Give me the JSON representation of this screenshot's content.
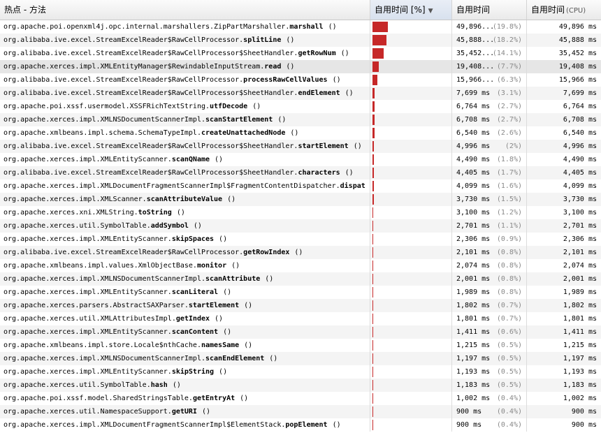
{
  "header": {
    "col_method": "热点 - 方法",
    "col_self_pct": "自用时间 [%]",
    "col_self_time": "自用时间",
    "col_cpu": "自用时间",
    "col_cpu_suffix": "(CPU)",
    "sort_icon": "triangle-down-icon"
  },
  "colors": {
    "bar": "#c62828",
    "selected_row": "#e6e6e6"
  },
  "rows": [
    {
      "pkg": "org.apache.poi.openxml4j.opc.internal.marshallers.ZipPartMarshaller.",
      "name": "marshall",
      "paren": "()",
      "time": "49,896...",
      "pct": "(19.8%)",
      "cpu": "49,896 ms",
      "share": 0.198
    },
    {
      "pkg": "org.alibaba.ive.excel.StreamExcelReader$RawCellProcessor.",
      "name": "splitLine",
      "paren": "()",
      "time": "45,888...",
      "pct": "(18.2%)",
      "cpu": "45,888 ms",
      "share": 0.182
    },
    {
      "pkg": "org.alibaba.ive.excel.StreamExcelReader$RawCellProcessor$SheetHandler.",
      "name": "getRowNum",
      "paren": "()",
      "time": "35,452...",
      "pct": "(14.1%)",
      "cpu": "35,452 ms",
      "share": 0.141
    },
    {
      "pkg": "org.apache.xerces.impl.XMLEntityManager$RewindableInputStream.",
      "name": "read",
      "paren": "()",
      "time": "19,408...",
      "pct": "(7.7%)",
      "cpu": "19,408 ms",
      "share": 0.077,
      "selected": true
    },
    {
      "pkg": "org.alibaba.ive.excel.StreamExcelReader$RawCellProcessor.",
      "name": "processRawCellValues",
      "paren": "()",
      "time": "15,966...",
      "pct": "(6.3%)",
      "cpu": "15,966 ms",
      "share": 0.063
    },
    {
      "pkg": "org.alibaba.ive.excel.StreamExcelReader$RawCellProcessor$SheetHandler.",
      "name": "endElement",
      "paren": "()",
      "time": "7,699 ms",
      "pct": "(3.1%)",
      "cpu": "7,699 ms",
      "share": 0.031
    },
    {
      "pkg": "org.apache.poi.xssf.usermodel.XSSFRichTextString.",
      "name": "utfDecode",
      "paren": "()",
      "time": "6,764 ms",
      "pct": "(2.7%)",
      "cpu": "6,764 ms",
      "share": 0.027
    },
    {
      "pkg": "org.apache.xerces.impl.XMLNSDocumentScannerImpl.",
      "name": "scanStartElement",
      "paren": "()",
      "time": "6,708 ms",
      "pct": "(2.7%)",
      "cpu": "6,708 ms",
      "share": 0.027
    },
    {
      "pkg": "org.apache.xmlbeans.impl.schema.SchemaTypeImpl.",
      "name": "createUnattachedNode",
      "paren": "()",
      "time": "6,540 ms",
      "pct": "(2.6%)",
      "cpu": "6,540 ms",
      "share": 0.026
    },
    {
      "pkg": "org.alibaba.ive.excel.StreamExcelReader$RawCellProcessor$SheetHandler.",
      "name": "startElement",
      "paren": "()",
      "time": "4,996 ms",
      "pct": "(2%)",
      "cpu": "4,996 ms",
      "share": 0.02
    },
    {
      "pkg": "org.apache.xerces.impl.XMLEntityScanner.",
      "name": "scanQName",
      "paren": "()",
      "time": "4,490 ms",
      "pct": "(1.8%)",
      "cpu": "4,490 ms",
      "share": 0.018
    },
    {
      "pkg": "org.alibaba.ive.excel.StreamExcelReader$RawCellProcessor$SheetHandler.",
      "name": "characters",
      "paren": "()",
      "time": "4,405 ms",
      "pct": "(1.7%)",
      "cpu": "4,405 ms",
      "share": 0.017
    },
    {
      "pkg": "org.apache.xerces.impl.XMLDocumentFragmentScannerImpl$FragmentContentDispatcher.",
      "name": "dispat",
      "paren": "",
      "time": "4,099 ms",
      "pct": "(1.6%)",
      "cpu": "4,099 ms",
      "share": 0.016
    },
    {
      "pkg": "org.apache.xerces.impl.XMLScanner.",
      "name": "scanAttributeValue",
      "paren": "()",
      "time": "3,730 ms",
      "pct": "(1.5%)",
      "cpu": "3,730 ms",
      "share": 0.015
    },
    {
      "pkg": "org.apache.xerces.xni.XMLString.",
      "name": "toString",
      "paren": "()",
      "time": "3,100 ms",
      "pct": "(1.2%)",
      "cpu": "3,100 ms",
      "share": 0.012
    },
    {
      "pkg": "org.apache.xerces.util.SymbolTable.",
      "name": "addSymbol",
      "paren": "()",
      "time": "2,701 ms",
      "pct": "(1.1%)",
      "cpu": "2,701 ms",
      "share": 0.011
    },
    {
      "pkg": "org.apache.xerces.impl.XMLEntityScanner.",
      "name": "skipSpaces",
      "paren": "()",
      "time": "2,306 ms",
      "pct": "(0.9%)",
      "cpu": "2,306 ms",
      "share": 0.009
    },
    {
      "pkg": "org.alibaba.ive.excel.StreamExcelReader$RawCellProcessor.",
      "name": "getRowIndex",
      "paren": "()",
      "time": "2,101 ms",
      "pct": "(0.8%)",
      "cpu": "2,101 ms",
      "share": 0.008
    },
    {
      "pkg": "org.apache.xmlbeans.impl.values.XmlObjectBase.",
      "name": "monitor",
      "paren": "()",
      "time": "2,074 ms",
      "pct": "(0.8%)",
      "cpu": "2,074 ms",
      "share": 0.008
    },
    {
      "pkg": "org.apache.xerces.impl.XMLNSDocumentScannerImpl.",
      "name": "scanAttribute",
      "paren": "()",
      "time": "2,001 ms",
      "pct": "(0.8%)",
      "cpu": "2,001 ms",
      "share": 0.008
    },
    {
      "pkg": "org.apache.xerces.impl.XMLEntityScanner.",
      "name": "scanLiteral",
      "paren": "()",
      "time": "1,989 ms",
      "pct": "(0.8%)",
      "cpu": "1,989 ms",
      "share": 0.008
    },
    {
      "pkg": "org.apache.xerces.parsers.AbstractSAXParser.",
      "name": "startElement",
      "paren": "()",
      "time": "1,802 ms",
      "pct": "(0.7%)",
      "cpu": "1,802 ms",
      "share": 0.007
    },
    {
      "pkg": "org.apache.xerces.util.XMLAttributesImpl.",
      "name": "getIndex",
      "paren": "()",
      "time": "1,801 ms",
      "pct": "(0.7%)",
      "cpu": "1,801 ms",
      "share": 0.007
    },
    {
      "pkg": "org.apache.xerces.impl.XMLEntityScanner.",
      "name": "scanContent",
      "paren": "()",
      "time": "1,411 ms",
      "pct": "(0.6%)",
      "cpu": "1,411 ms",
      "share": 0.006
    },
    {
      "pkg": "org.apache.xmlbeans.impl.store.Locale$nthCache.",
      "name": "namesSame",
      "paren": "()",
      "time": "1,215 ms",
      "pct": "(0.5%)",
      "cpu": "1,215 ms",
      "share": 0.005
    },
    {
      "pkg": "org.apache.xerces.impl.XMLNSDocumentScannerImpl.",
      "name": "scanEndElement",
      "paren": "()",
      "time": "1,197 ms",
      "pct": "(0.5%)",
      "cpu": "1,197 ms",
      "share": 0.005
    },
    {
      "pkg": "org.apache.xerces.impl.XMLEntityScanner.",
      "name": "skipString",
      "paren": "()",
      "time": "1,193 ms",
      "pct": "(0.5%)",
      "cpu": "1,193 ms",
      "share": 0.005
    },
    {
      "pkg": "org.apache.xerces.util.SymbolTable.",
      "name": "hash",
      "paren": "()",
      "time": "1,183 ms",
      "pct": "(0.5%)",
      "cpu": "1,183 ms",
      "share": 0.005
    },
    {
      "pkg": "org.apache.poi.xssf.model.SharedStringsTable.",
      "name": "getEntryAt",
      "paren": "()",
      "time": "1,002 ms",
      "pct": "(0.4%)",
      "cpu": "1,002 ms",
      "share": 0.004
    },
    {
      "pkg": "org.apache.xerces.util.NamespaceSupport.",
      "name": "getURI",
      "paren": "()",
      "time": "900 ms",
      "pct": "(0.4%)",
      "cpu": "900 ms",
      "share": 0.004
    },
    {
      "pkg": "org.apache.xerces.impl.XMLDocumentFragmentScannerImpl$ElementStack.",
      "name": "popElement",
      "paren": "()",
      "time": "900 ms",
      "pct": "(0.4%)",
      "cpu": "900 ms",
      "share": 0.004
    }
  ]
}
